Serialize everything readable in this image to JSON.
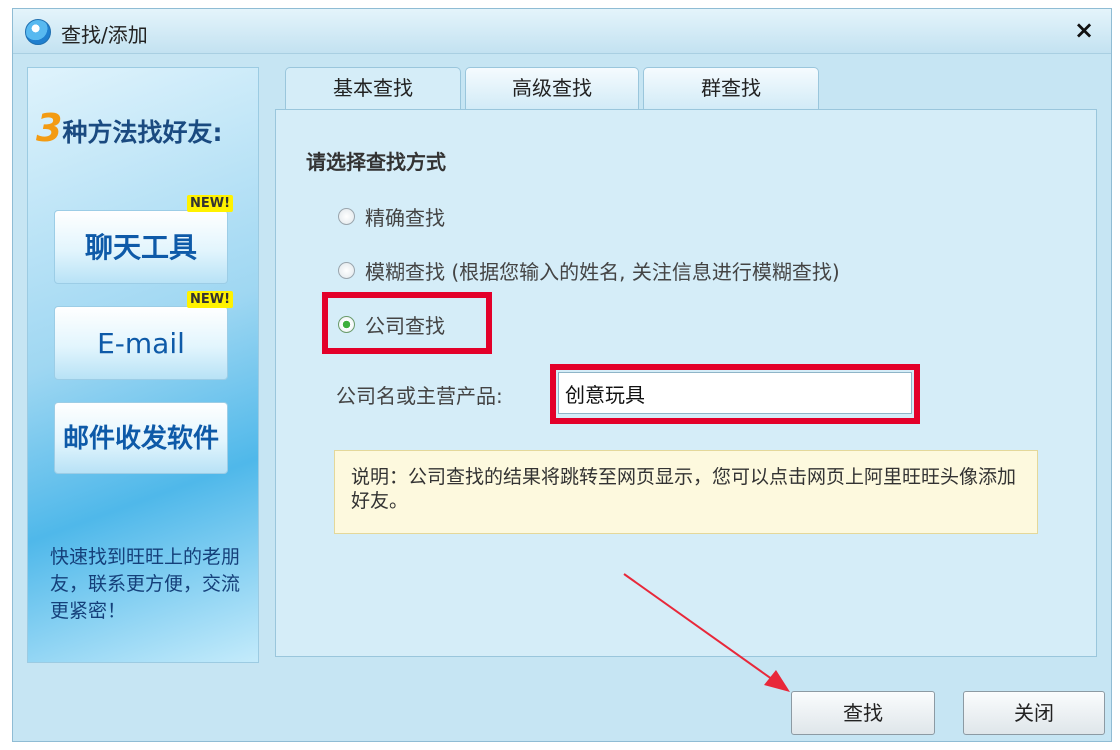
{
  "window": {
    "title": "查找/添加",
    "close_glyph": "×"
  },
  "sidebar": {
    "headline_num": "3",
    "headline_text": "种方法找好友:",
    "buttons": [
      {
        "label": "聊天工具",
        "badge": "NEW!"
      },
      {
        "label": "E-mail",
        "badge": "NEW!"
      },
      {
        "label": "邮件收发软件",
        "badge": ""
      }
    ],
    "footer": "快速找到旺旺上的老朋友，联系更方便，交流更紧密！"
  },
  "tabs": [
    {
      "label": "基本查找",
      "active": true
    },
    {
      "label": "高级查找",
      "active": false
    },
    {
      "label": "群查找",
      "active": false
    }
  ],
  "form": {
    "section_title": "请选择查找方式",
    "options": [
      {
        "label": "精确查找",
        "checked": false
      },
      {
        "label": "模糊查找 (根据您输入的姓名, 关注信息进行模糊查找)",
        "checked": false
      },
      {
        "label": "公司查找",
        "checked": true
      }
    ],
    "company_label": "公司名或主营产品:",
    "company_value": "创意玩具",
    "note": "说明：公司查找的结果将跳转至网页显示，您可以点击网页上阿里旺旺头像添加好友。"
  },
  "buttons": {
    "search": "查找",
    "close": "关闭"
  },
  "colors": {
    "highlight": "#e3002a",
    "annotation_arrow": "#e8283a",
    "accent": "#0e5aa8"
  },
  "icons": {
    "app": "aliwangwang-logo-icon",
    "close": "close-icon",
    "checked_radio": "radio-checked-icon"
  }
}
